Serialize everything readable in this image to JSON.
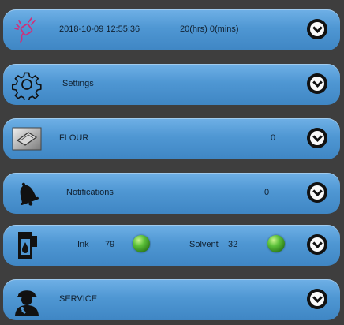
{
  "status": {
    "datetime": "2018-10-09 12:55:36",
    "runtime": "20(hrs) 0(mins)"
  },
  "settings": {
    "label": "Settings"
  },
  "flour": {
    "label": "FLOUR",
    "value": "0"
  },
  "notifications": {
    "label": "Notifications",
    "value": "0"
  },
  "consumables": {
    "ink_label": "Ink",
    "ink_value": "79",
    "solvent_label": "Solvent",
    "solvent_value": "32"
  },
  "service": {
    "label": "SERVICE"
  },
  "colors": {
    "panel": "#4f97d3",
    "background": "#3e3e3e",
    "plug_icon": "#d0307a",
    "led_ok": "#5cc13a"
  },
  "icons": [
    "plug-icon",
    "gear-icon",
    "flour-bag-icon",
    "bell-icon",
    "ink-cartridge-icon",
    "service-technician-icon",
    "chevron-down-icon"
  ]
}
